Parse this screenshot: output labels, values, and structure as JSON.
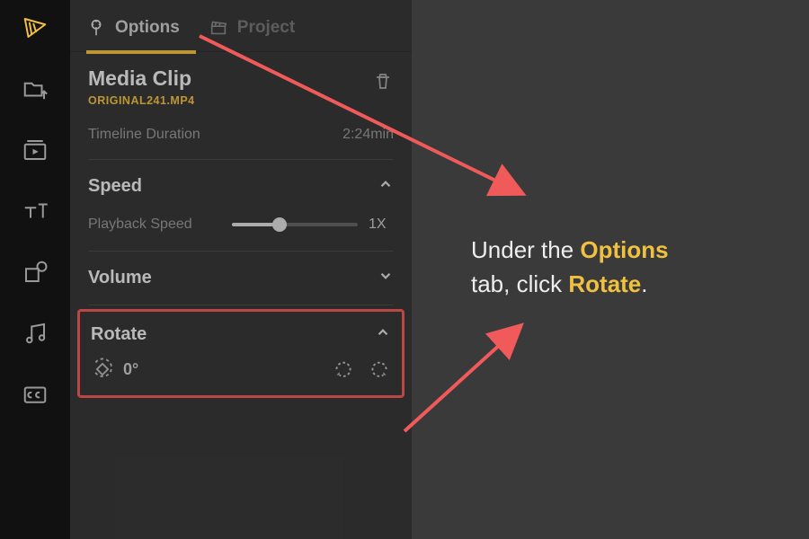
{
  "tabs": {
    "options": "Options",
    "project": "Project"
  },
  "media": {
    "title": "Media Clip",
    "filename": "ORIGINAL241.MP4",
    "duration_label": "Timeline Duration",
    "duration_value": "2:24min"
  },
  "speed": {
    "title": "Speed",
    "playback_label": "Playback Speed",
    "value_text": "1X"
  },
  "volume": {
    "title": "Volume"
  },
  "rotate": {
    "title": "Rotate",
    "degrees": "0°"
  },
  "instruction": {
    "p1a": "Under the ",
    "p1b": "Options",
    "p2a": " tab, click ",
    "p2b": "Rotate",
    "p2c": "."
  },
  "colors": {
    "accent": "#f0c040",
    "highlight_box": "#f05a5a"
  }
}
